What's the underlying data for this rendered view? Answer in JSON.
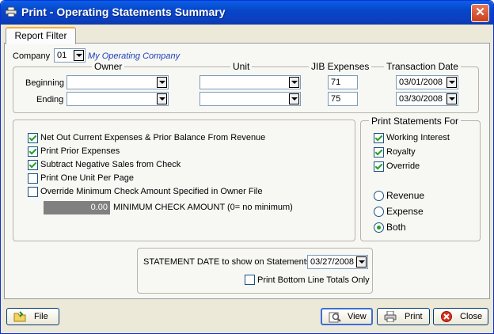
{
  "window": {
    "title": "Print - Operating Statements Summary"
  },
  "tabs": [
    {
      "label": "Report Filter"
    }
  ],
  "company": {
    "label": "Company",
    "code": "01",
    "name": "My Operating Company"
  },
  "filter_headers": {
    "owner": "Owner",
    "unit": "Unit",
    "jib": "JIB Expenses",
    "trans_date": "Transaction Date"
  },
  "rows": {
    "beginning": {
      "label": "Beginning",
      "owner": "",
      "unit": "",
      "jib": "71",
      "date": "03/01/2008"
    },
    "ending": {
      "label": "Ending",
      "owner": "",
      "unit": "",
      "jib": "75",
      "date": "03/30/2008"
    }
  },
  "options": [
    {
      "label": "Net Out Current Expenses & Prior Balance From Revenue",
      "checked": true
    },
    {
      "label": "Print Prior Expenses",
      "checked": true
    },
    {
      "label": "Subtract Negative Sales from Check",
      "checked": true
    },
    {
      "label": "Print One Unit Per Page",
      "checked": false
    },
    {
      "label": "Override Minimum Check Amount Specified in Owner File",
      "checked": false
    }
  ],
  "min_check": {
    "value": "0.00",
    "label": "MINIMUM CHECK AMOUNT (0= no minimum)"
  },
  "print_for": {
    "title": "Print Statements For",
    "checks": [
      {
        "label": "Working Interest",
        "checked": true
      },
      {
        "label": "Royalty",
        "checked": true
      },
      {
        "label": "Override",
        "checked": true
      }
    ],
    "radios": [
      {
        "label": "Revenue",
        "selected": false
      },
      {
        "label": "Expense",
        "selected": false
      },
      {
        "label": "Both",
        "selected": true
      }
    ]
  },
  "statement": {
    "label": "STATEMENT DATE to show on Statements",
    "date": "03/27/2008",
    "bottom_line_label": "Print Bottom Line Totals Only",
    "bottom_line_checked": false
  },
  "buttons": {
    "file": "File",
    "view": "View",
    "print": "Print",
    "close": "Close"
  }
}
